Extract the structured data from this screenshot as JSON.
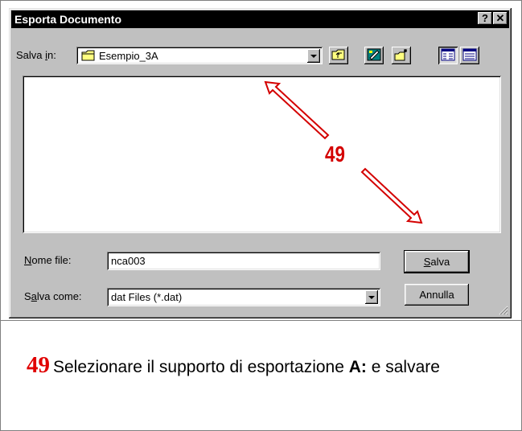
{
  "dialog": {
    "title": "Esporta Documento",
    "help_label": "?",
    "close_label": "✕",
    "save_in": {
      "label_pre": "Salva ",
      "label_accel": "i",
      "label_post": "n:",
      "value": "Esempio_3A"
    },
    "file_name": {
      "label_accel": "N",
      "label_post": "ome file:",
      "value": "nca003"
    },
    "save_as": {
      "label_pre": "S",
      "label_accel": "a",
      "label_post": "lva come:",
      "value": "dat Files (*.dat)"
    },
    "buttons": {
      "save_accel": "S",
      "save_post": "alva",
      "cancel": "Annulla"
    },
    "toolbar": [
      "up-one-level",
      "desktop",
      "new-folder",
      "list-view",
      "details-view"
    ]
  },
  "annotation": {
    "step": "49",
    "color": "#d40000"
  },
  "caption": {
    "step": "49",
    "text_pre": "Selezionare il supporto di esportazione ",
    "text_bold": "A:",
    "text_post": " e salvare"
  }
}
